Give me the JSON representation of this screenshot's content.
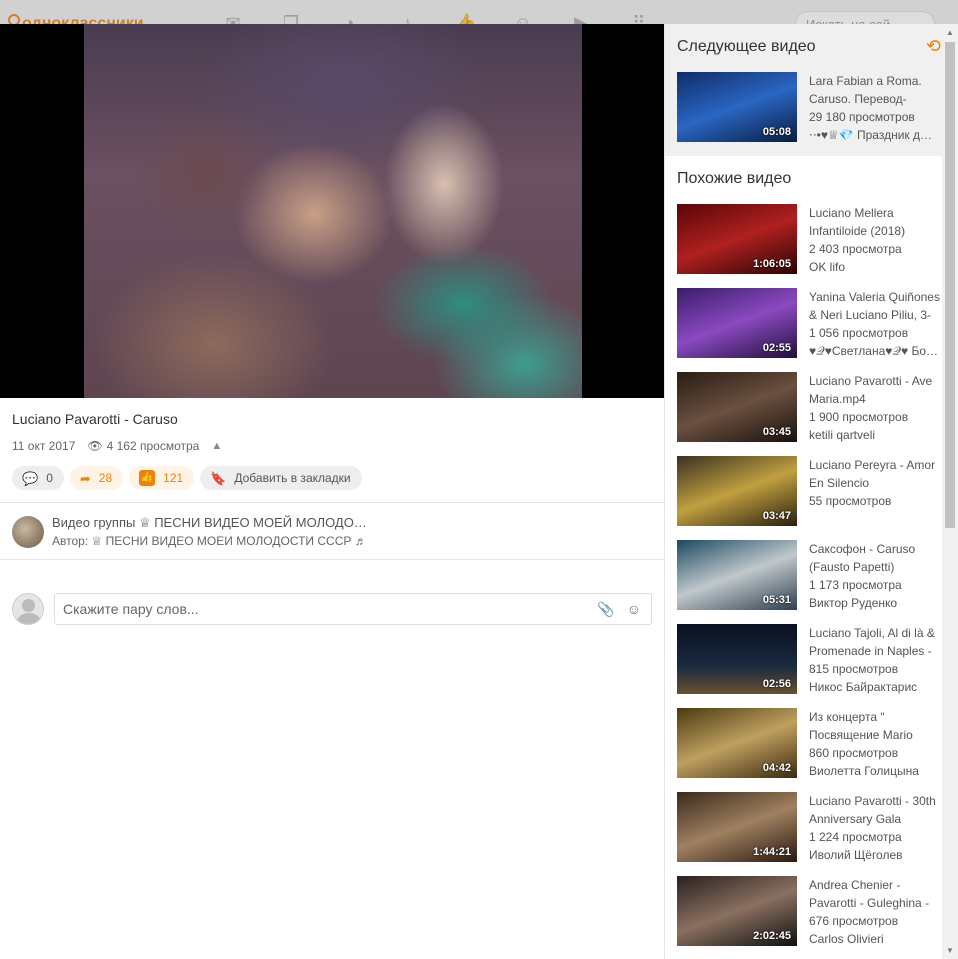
{
  "site": {
    "logo": "одноклассники",
    "search_placeholder": "Искать на сай"
  },
  "video": {
    "title": "Luciano Pavarotti - Caruso",
    "date": "11 окт 2017",
    "views": "4 162 просмотра",
    "comments_count": "0",
    "shares_count": "28",
    "likes_count": "121",
    "bookmark_label": "Добавить в закладки"
  },
  "group": {
    "line1": "Видео группы ♕ ПЕСНИ ВИДЕО МОЕЙ МОЛОДО…",
    "line2": "Автор: ♕ ПЕСНИ ВИДЕО МОЕИ МОЛОДОСТИ СССР ♬"
  },
  "comment": {
    "placeholder": "Скажите пару слов..."
  },
  "sidebar": {
    "next_title": "Следующее видео",
    "similar_title": "Похожие видео",
    "next": {
      "title1": "Lara Fabian a Roma.",
      "title2": "Caruso. Перевод-",
      "views": "29 180 просмотров",
      "channel": "⋅⋅•♥♕💎 Праздник д…",
      "duration": "05:08"
    },
    "similar": [
      {
        "t1": "Luciano Mellera",
        "t2": "Infantiloide (2018)",
        "views": "2 403 просмотра",
        "channel": "OK lifo",
        "duration": "1:06:05"
      },
      {
        "t1": "Yanina Valeria Quiñones",
        "t2": "& Neri Luciano Piliu, 3-",
        "views": "1 056 просмотров",
        "channel": "♥𝒬♥Светлана♥𝒬♥ Бо…",
        "duration": "02:55"
      },
      {
        "t1": "Luciano Pavarotti - Ave",
        "t2": "Maria.mp4",
        "views": "1 900 просмотров",
        "channel": "ketili qartveli",
        "duration": "03:45"
      },
      {
        "t1": "Luciano Pereyra - Amor",
        "t2": "En Silencio",
        "views": "55 просмотров",
        "channel": "",
        "duration": "03:47"
      },
      {
        "t1": "Саксофон - Caruso",
        "t2": "(Fausto Papetti)",
        "views": "1 173 просмотра",
        "channel": "Виктор Руденко",
        "duration": "05:31"
      },
      {
        "t1": "Luciano Tajoli, Al di là &",
        "t2": "Promenade in Naples -",
        "views": "815 просмотров",
        "channel": "Никос Байрактарис",
        "duration": "02:56"
      },
      {
        "t1": "Из концерта \"",
        "t2": "Посвящение Mario",
        "views": "860 просмотров",
        "channel": "Виолетта Голицына",
        "duration": "04:42"
      },
      {
        "t1": "Luciano Pavarotti - 30th",
        "t2": "Anniversary Gala",
        "views": "1 224 просмотра",
        "channel": "Иволий Щёголев",
        "duration": "1:44:21"
      },
      {
        "t1": "Andrea Chenier -",
        "t2": "Pavarotti - Guleghina -",
        "views": "676 просмотров",
        "channel": "Carlos Olivieri",
        "duration": "2:02:45"
      }
    ]
  },
  "thumb_colors": [
    "#1f4f9a",
    "#8a1010",
    "#5a2d8a",
    "#3a2a20",
    "#3a3020",
    "#2a6a80",
    "#1a2030",
    "#5a4a20",
    "#4a3a2a",
    "#2a2a2a"
  ]
}
